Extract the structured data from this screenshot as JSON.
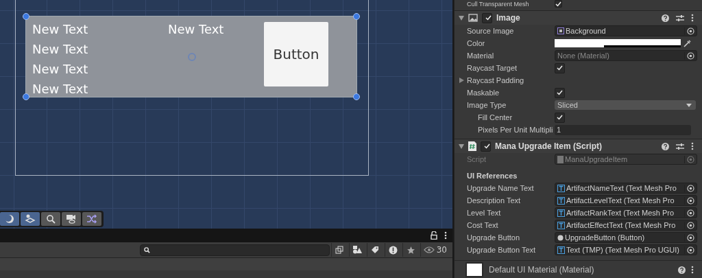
{
  "scene": {
    "left_texts": [
      "New Text",
      "New Text",
      "New Text",
      "New Text"
    ],
    "center_text": "New Text",
    "button_label": "Button"
  },
  "hierarchy_bar": {
    "visible_count": "30"
  },
  "inspector": {
    "top_row": {
      "label": "Cull Transparent Mesh",
      "checked": true
    },
    "components": [
      {
        "title": "Image",
        "enabled": true,
        "kind": "image",
        "fields": [
          {
            "kind": "sprite-object",
            "label": "Source Image",
            "value": "Background",
            "disabled": false
          },
          {
            "kind": "color",
            "label": "Color"
          },
          {
            "kind": "material-object",
            "label": "Material",
            "value": "None (Material)",
            "disabled": false
          },
          {
            "kind": "checkbox",
            "label": "Raycast Target",
            "checked": true
          },
          {
            "kind": "foldout",
            "label": "Raycast Padding",
            "expanded": false
          },
          {
            "kind": "checkbox",
            "label": "Maskable",
            "checked": true
          },
          {
            "kind": "dropdown",
            "label": "Image Type",
            "value": "Sliced"
          },
          {
            "kind": "checkbox",
            "label": "Fill Center",
            "checked": true,
            "indent": true
          },
          {
            "kind": "number",
            "label": "Pixels Per Unit Multipli",
            "value": "1",
            "indent": true
          }
        ]
      },
      {
        "title": "Mana Upgrade Item (Script)",
        "enabled": true,
        "kind": "script",
        "fields": [
          {
            "kind": "script-object",
            "label": "Script",
            "value": "ManaUpgradeItem",
            "disabled": true
          },
          {
            "kind": "header",
            "label": "UI References"
          },
          {
            "kind": "text-object",
            "label": "Upgrade Name Text",
            "value": "ArtifactNameText (Text Mesh Pro",
            "disabled": false
          },
          {
            "kind": "text-object",
            "label": "Description Text",
            "value": "ArtifactLevelText (Text Mesh Pro",
            "disabled": false
          },
          {
            "kind": "text-object",
            "label": "Level Text",
            "value": "ArtifactRankText (Text Mesh Pro",
            "disabled": false
          },
          {
            "kind": "text-object",
            "label": "Cost Text",
            "value": "ArtifactEffectText (Text Mesh Pro",
            "disabled": false
          },
          {
            "kind": "button-object",
            "label": "Upgrade Button",
            "value": "UpgradeButton (Button)",
            "disabled": false
          },
          {
            "kind": "text-object",
            "label": "Upgrade Button Text",
            "value": "Text (TMP) (Text Mesh Pro UGUI)",
            "disabled": false
          }
        ]
      }
    ],
    "material": {
      "name": "Default UI Material (Material)"
    }
  }
}
